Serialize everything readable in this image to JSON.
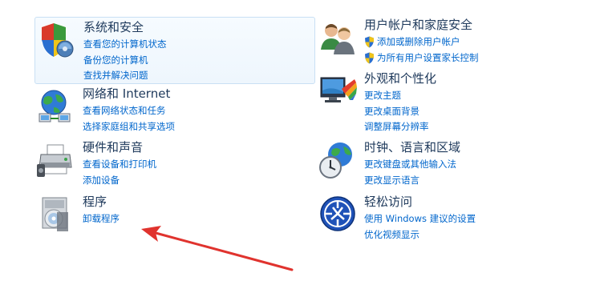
{
  "categories": [
    {
      "title": "系统和安全",
      "icon": "security-shield-icon",
      "links": [
        {
          "label": "查看您的计算机状态"
        },
        {
          "label": "备份您的计算机"
        },
        {
          "label": "查找并解决问题"
        }
      ]
    },
    {
      "title": "网络和 Internet",
      "icon": "network-globe-icon",
      "links": [
        {
          "label": "查看网络状态和任务"
        },
        {
          "label": "选择家庭组和共享选项"
        }
      ]
    },
    {
      "title": "硬件和声音",
      "icon": "printer-icon",
      "links": [
        {
          "label": "查看设备和打印机"
        },
        {
          "label": "添加设备"
        }
      ]
    },
    {
      "title": "程序",
      "icon": "programs-disc-icon",
      "links": [
        {
          "label": "卸载程序"
        }
      ]
    },
    {
      "title": "用户帐户和家庭安全",
      "icon": "users-icon",
      "links": [
        {
          "label": "添加或删除用户帐户",
          "shield": true
        },
        {
          "label": "为所有用户设置家长控制",
          "shield": true
        }
      ]
    },
    {
      "title": "外观和个性化",
      "icon": "appearance-monitor-icon",
      "links": [
        {
          "label": "更改主题"
        },
        {
          "label": "更改桌面背景"
        },
        {
          "label": "调整屏幕分辨率"
        }
      ]
    },
    {
      "title": "时钟、语言和区域",
      "icon": "clock-globe-icon",
      "links": [
        {
          "label": "更改键盘或其他输入法"
        },
        {
          "label": "更改显示语言"
        }
      ]
    },
    {
      "title": "轻松访问",
      "icon": "ease-of-access-icon",
      "links": [
        {
          "label": "使用 Windows 建议的设置"
        },
        {
          "label": "优化视频显示"
        }
      ]
    }
  ],
  "colors": {
    "title": "#1e395b",
    "link": "#0066cc",
    "highlight_bg": "#eef6fd",
    "highlight_border": "#c9e0f4",
    "annotation_arrow": "#e0332e"
  },
  "annotation": {
    "icon": "red-arrow-icon"
  }
}
